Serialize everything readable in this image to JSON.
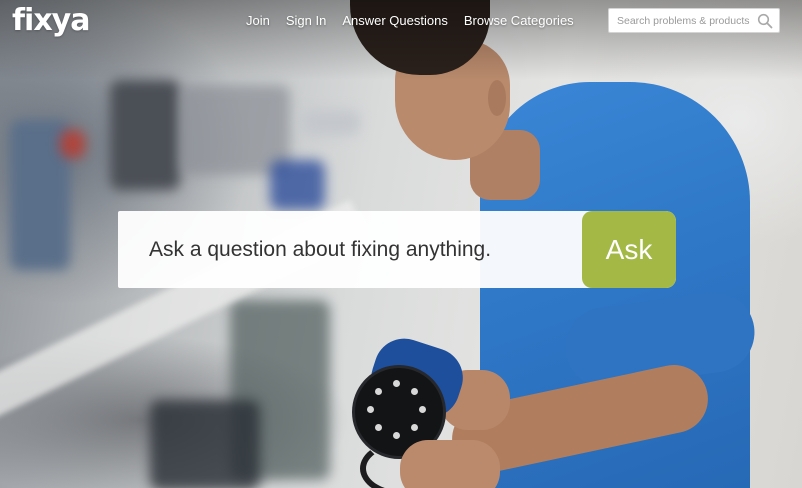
{
  "header": {
    "logo_text": "fixya",
    "nav": [
      {
        "label": "Join"
      },
      {
        "label": "Sign In"
      },
      {
        "label": "Answer Questions"
      },
      {
        "label": "Browse Categories"
      }
    ],
    "search": {
      "placeholder": "Search problems & products",
      "icon": "search-icon"
    }
  },
  "hero": {
    "ask_placeholder": "Ask a question about fixing anything.",
    "ask_button_label": "Ask",
    "accent_color": "#a3b845"
  }
}
